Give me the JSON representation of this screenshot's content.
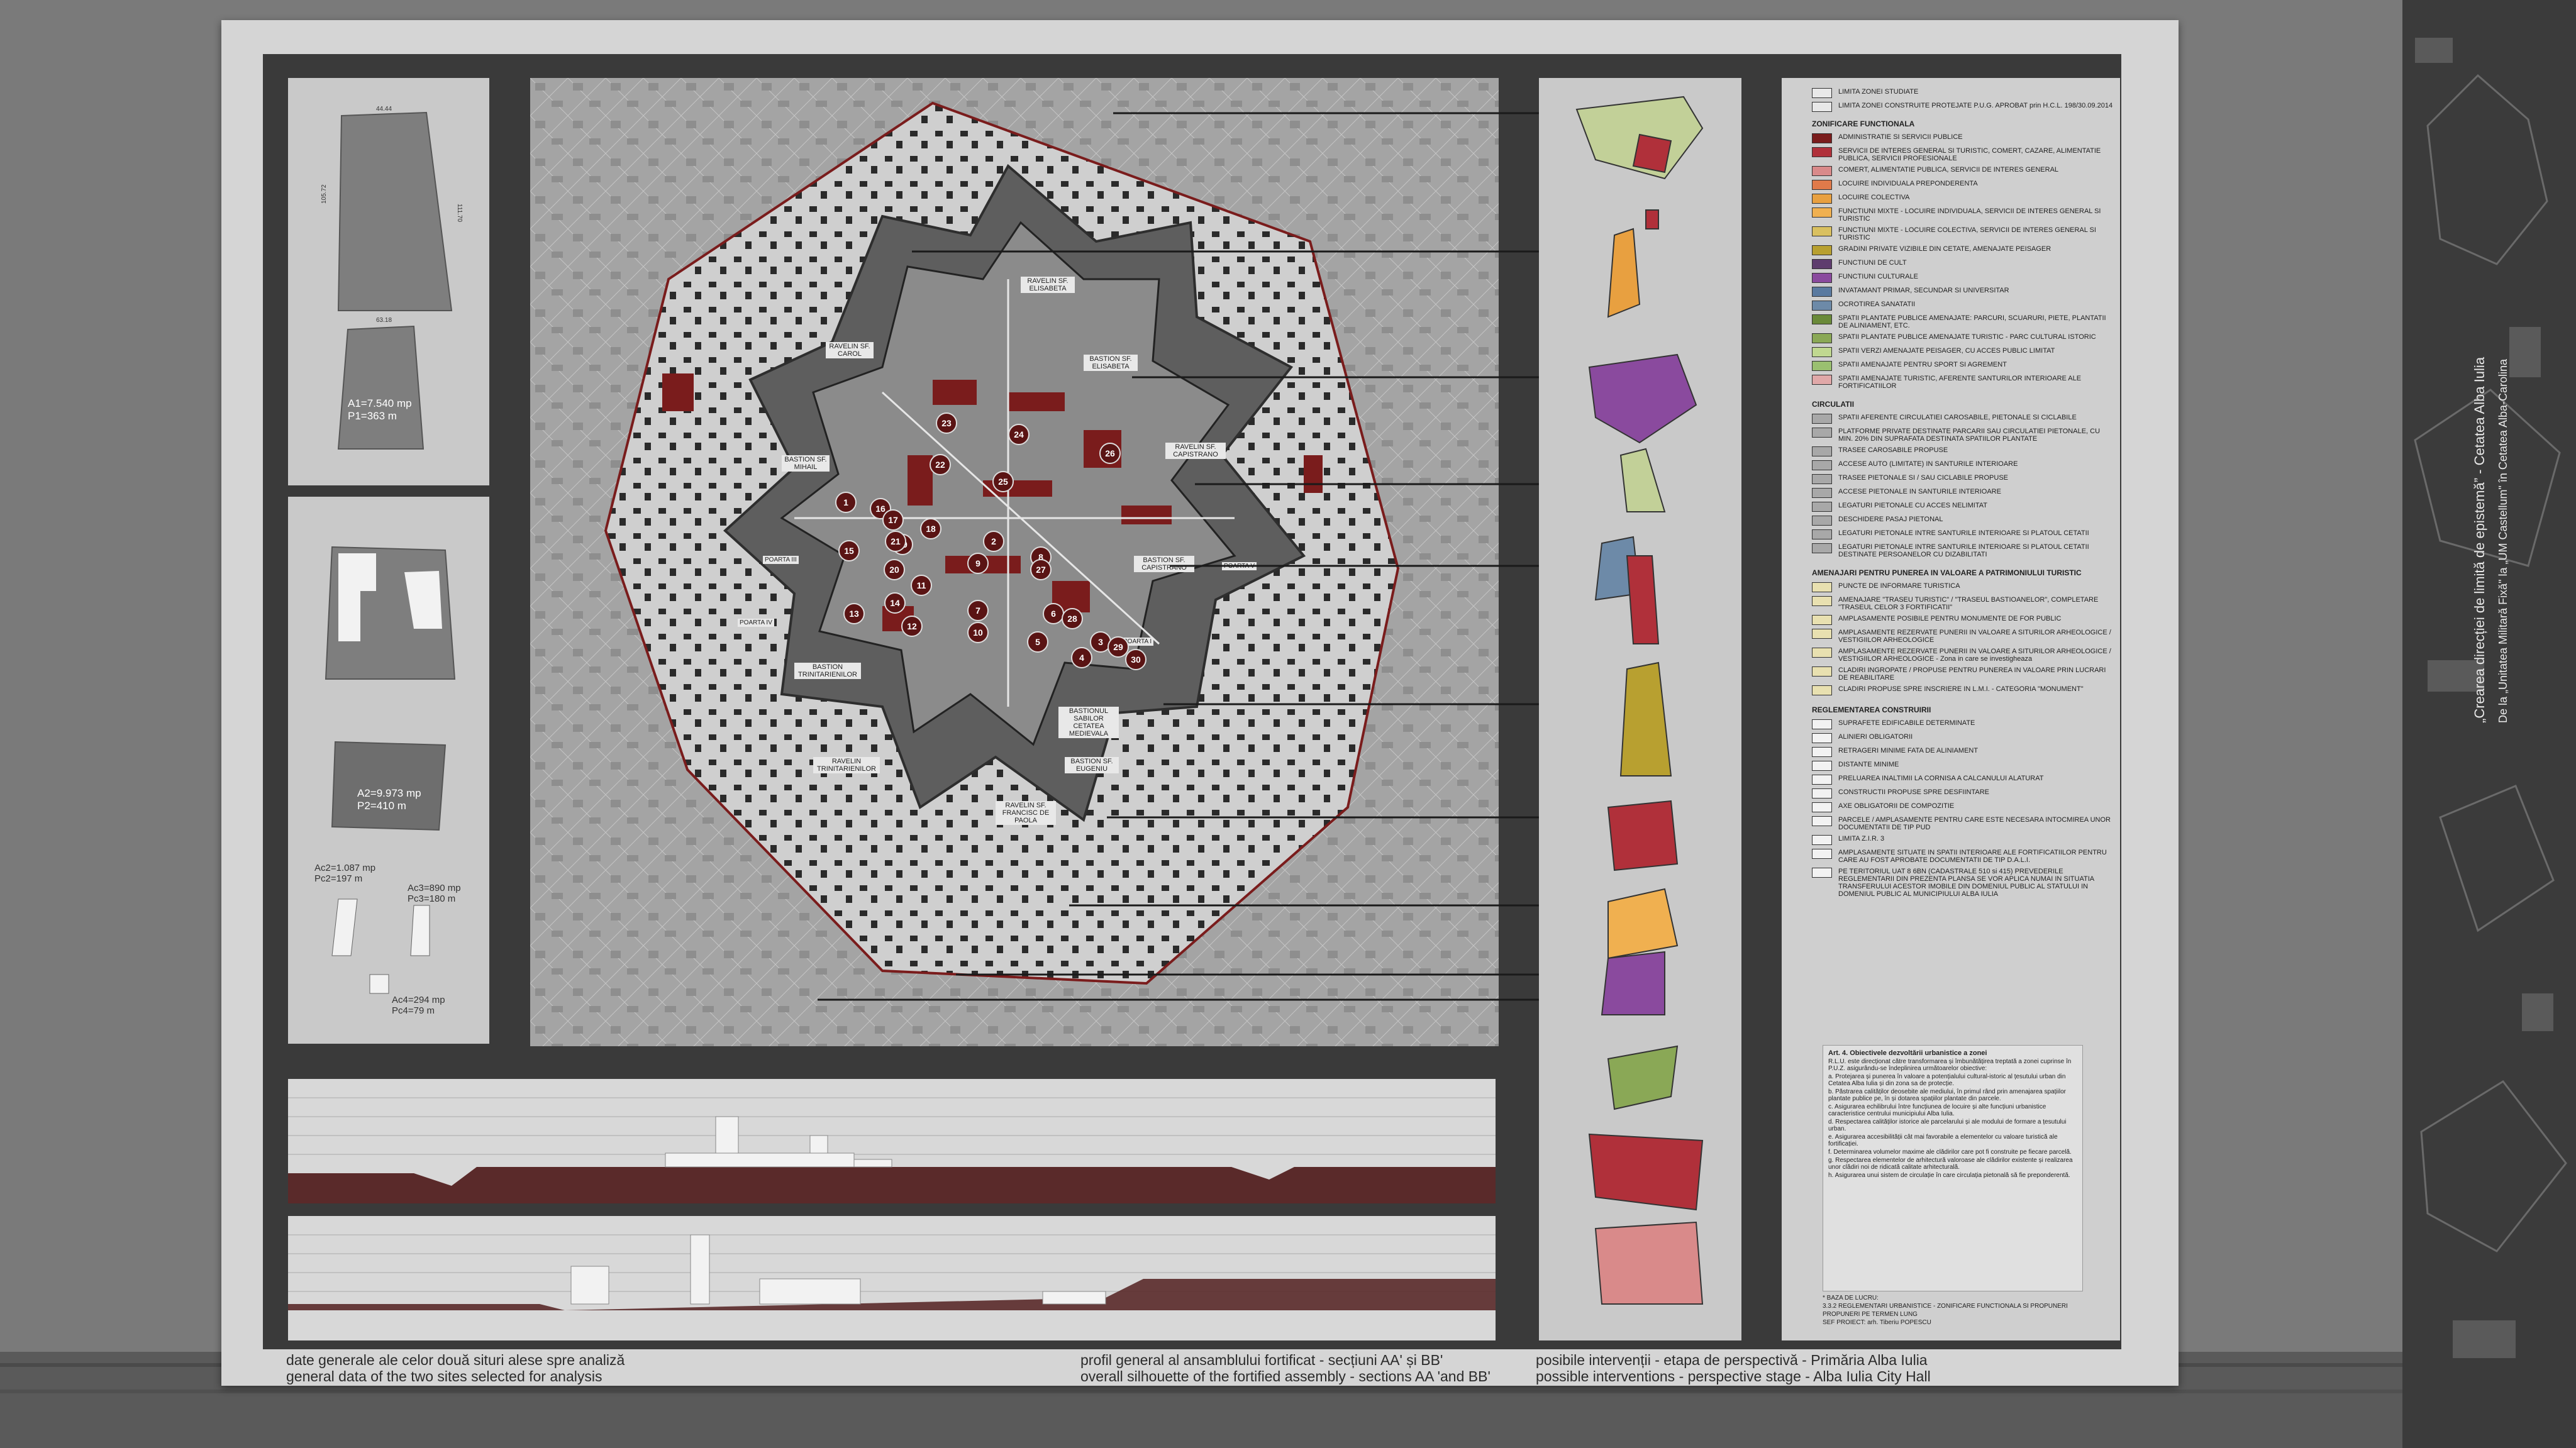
{
  "captions": {
    "left_ro": "date generale ale celor două situri alese spre analiză",
    "left_en": "general data of the two sites selected for analysis",
    "mid_ro": "profil general al ansamblului fortificat - secțiuni AA' și BB'",
    "mid_en": "overall silhouette of the fortified assembly - sections AA 'and BB'",
    "right_ro": "posibile intervenții - etapa de perspectivă - Primăria Alba Iulia",
    "right_en": "possible interventions - perspective stage - Alba Iulia City Hall"
  },
  "site_data": {
    "a1": "A1=7.540 mp",
    "p1": "P1=363 m",
    "a2": "A2=9.973 mp",
    "p2": "P2=410 m",
    "ac2": "Ac2=1.087 mp",
    "pc2": "Pc2=197 m",
    "ac3": "Ac3=890 mp",
    "pc3": "Pc3=180 m",
    "ac4": "Ac4=294 mp",
    "pc4": "Pc4=79 m"
  },
  "map_labels": {
    "ravelin_elisabeta": "RAVELIN SF. ELISABETA",
    "ravelin_carol": "RAVELIN SF. CAROL",
    "bastion_elisabeta": "BASTION SF. ELISABETA",
    "bastion_mihail": "BASTION SF. MIHAIL",
    "ravelin_capistrano": "RAVELIN SF. CAPISTRANO",
    "bastion_capistrano": "BASTION SF. CAPISTRANO",
    "bastion_treime": "BASTION TRINITARIENILOR",
    "bastion_eugeniu": "BASTION SF. EUGENIU",
    "ravelin_treime": "RAVELIN TRINITARIENILOR",
    "ravelin_paola": "RAVELIN SF. FRANCISC DE PAOLA",
    "bastion_medievala": "BASTIONUL SABILOR CETATEA MEDIEVALA",
    "poarta_1": "POARTA III",
    "poarta_2": "POARTA IV",
    "poarta_3": "POARTA V",
    "poarta_4": "POARTA I"
  },
  "markers": [
    "1",
    "2",
    "3",
    "4",
    "5",
    "6",
    "7",
    "8",
    "9",
    "10",
    "11",
    "12",
    "13",
    "14",
    "15",
    "16",
    "17",
    "18",
    "19",
    "20",
    "21",
    "22",
    "23",
    "24",
    "25",
    "26",
    "27",
    "28",
    "29",
    "30"
  ],
  "legend": {
    "items_top": [
      "LIMITA ZONEI STUDIATE",
      "LIMITA ZONEI CONSTRUITE PROTEJATE P.U.G. APROBAT prin H.C.L. 198/30.09.2014"
    ],
    "h_zoning": "ZONIFICARE FUNCTIONALA",
    "zoning": [
      {
        "color": "#7a1c1c",
        "label": "ADMINISTRATIE SI SERVICII PUBLICE"
      },
      {
        "color": "#b0303a",
        "label": "SERVICII DE INTERES GENERAL SI TURISTIC, COMERT, CAZARE, ALIMENTATIE PUBLICA, SERVICII PROFESIONALE"
      },
      {
        "color": "#d98a8a",
        "label": "COMERT, ALIMENTATIE PUBLICA, SERVICII DE INTERES GENERAL"
      },
      {
        "color": "#e07a4a",
        "label": "LOCUIRE INDIVIDUALA PREPONDERENTA"
      },
      {
        "color": "#e8a040",
        "label": "LOCUIRE COLECTIVA"
      },
      {
        "color": "#f0b050",
        "label": "FUNCTIUNI MIXTE - LOCUIRE INDIVIDUALA, SERVICII DE INTERES GENERAL SI TURISTIC"
      },
      {
        "color": "#d9c060",
        "label": "FUNCTIUNI MIXTE - LOCUIRE COLECTIVA, SERVICII DE INTERES GENERAL SI TURISTIC"
      },
      {
        "color": "#b8a030",
        "label": "GRADINI PRIVATE VIZIBILE DIN CETATE, AMENAJATE PEISAGER"
      },
      {
        "color": "#5e3c6e",
        "label": "FUNCTIUNI DE CULT"
      },
      {
        "color": "#8a4a9e",
        "label": "FUNCTIUNI CULTURALE"
      },
      {
        "color": "#5a7aa0",
        "label": "INVATAMANT PRIMAR, SECUNDAR SI UNIVERSITAR"
      },
      {
        "color": "#6d8aa8",
        "label": "OCROTIREA SANATATII"
      },
      {
        "color": "#6a8a3a",
        "label": "SPATII PLANTATE PUBLICE AMENAJATE: PARCURI, SCUARURI, PIETE, PLANTATII DE ALINIAMENT, ETC."
      },
      {
        "color": "#8aa856",
        "label": "SPATII PLANTATE PUBLICE AMENAJATE TURISTIC - PARC CULTURAL ISTORIC"
      },
      {
        "color": "#c0d890",
        "label": "SPATII VERZI AMENAJATE PEISAGER, CU ACCES PUBLIC LIMITAT"
      },
      {
        "color": "#9ac070",
        "label": "SPATII AMENAJATE PENTRU SPORT SI AGREMENT"
      },
      {
        "color": "#e0a8a8",
        "label": "SPATII AMENAJATE TURISTIC, AFERENTE SANTURILOR INTERIOARE ALE FORTIFICATIILOR"
      }
    ],
    "h_circ": "CIRCULATII",
    "circ": [
      "SPATII AFERENTE CIRCULATIEI CAROSABILE, PIETONALE SI CICLABILE",
      "PLATFORME PRIVATE DESTINATE PARCARII SAU CIRCULATIEI PIETONALE, CU MIN. 20% DIN SUPRAFATA DESTINATA SPATIILOR PLANTATE",
      "TRASEE CAROSABILE PROPUSE",
      "ACCESE AUTO (LIMITATE) IN SANTURILE INTERIOARE",
      "TRASEE PIETONALE SI / SAU CICLABILE PROPUSE",
      "ACCESE PIETONALE IN SANTURILE INTERIOARE",
      "LEGATURI PIETONALE CU ACCES NELIMITAT",
      "DESCHIDERE PASAJ PIETONAL",
      "LEGATURI PIETONALE INTRE SANTURILE INTERIOARE SI PLATOUL CETATII",
      "LEGATURI PIETONALE INTRE SANTURILE INTERIOARE SI PLATOUL CETATII DESTINATE PERSOANELOR CU DIZABILITATI"
    ],
    "h_amen": "AMENAJARI PENTRU PUNEREA IN VALOARE A PATRIMONIULUI TURISTIC",
    "amen": [
      "PUNCTE DE INFORMARE TURISTICA",
      "AMENAJARE \"TRASEU TURISTIC\" / \"TRASEUL BASTIOANELOR\", COMPLETARE \"TRASEUL CELOR 3 FORTIFICATII\"",
      "AMPLASAMENTE POSIBILE PENTRU MONUMENTE DE FOR PUBLIC",
      "AMPLASAMENTE REZERVATE PUNERII IN VALOARE A SITURILOR ARHEOLOGICE / VESTIGIILOR ARHEOLOGICE",
      "AMPLASAMENTE REZERVATE PUNERII IN VALOARE A SITURILOR ARHEOLOGICE / VESTIGIILOR ARHEOLOGICE - Zona in care se investigheaza",
      "CLADIRI INGROPATE / PROPUSE PENTRU PUNEREA IN VALOARE PRIN LUCRARI DE REABILITARE",
      "CLADIRI PROPUSE SPRE INSCRIERE IN L.M.I. - CATEGORIA \"MONUMENT\""
    ],
    "h_regl": "REGLEMENTAREA CONSTRUIRII",
    "regl": [
      "SUPRAFETE EDIFICABILE DETERMINATE",
      "ALINIERI OBLIGATORII",
      "RETRAGERI MINIME FATA DE ALINIAMENT",
      "DISTANTE MINIME",
      "PRELUAREA INALTIMII LA CORNISA A CALCANULUI ALATURAT",
      "CONSTRUCTII PROPUSE SPRE DESFIINTARE",
      "AXE OBLIGATORII DE COMPOZITIE",
      "PARCELE / AMPLASAMENTE PENTRU CARE ESTE NECESARA INTOCMIREA UNOR DOCUMENTATII DE TIP PUD",
      "LIMITA Z.I.R. 3",
      "AMPLASAMENTE SITUATE IN SPATII INTERIOARE ALE FORTIFICATIILOR PENTRU CARE AU FOST APROBATE DOCUMENTATII DE TIP D.A.L.I.",
      "PE TERITORIUL UAT 8 6BN (CADASTRALE 510 si 415) PREVEDERILE REGLEMENTARII DIN PREZENTA PLANSA SE VOR APLICA NUMAI IN SITUATIA TRANSFERULUI ACESTOR IMOBILE DIN DOMENIUL PUBLIC AL STATULUI IN DOMENIUL PUBLIC AL MUNICIPIULUI ALBA IULIA"
    ]
  },
  "objectives": {
    "title": "Art. 4. Obiectivele dezvoltării urbanistice a zonei",
    "intro": "R.L.U. este direcționat către transformarea și îmbunătățirea treptată a zonei cuprinse în P.U.Z. asigurându-se îndeplinirea următoarelor obiective:",
    "items": [
      "a. Protejarea și punerea în valoare a potențialului cultural-istoric al țesutului urban din Cetatea Alba Iulia și din zona sa de protecție.",
      "b. Păstrarea calităților deosebite ale mediului, în primul rând prin amenajarea spațiilor plantate publice pe, în și dotarea spațiilor plantate din parcele.",
      "c. Asigurarea echilibrului între funcțiunea de locuire și alte funcțiuni urbanistice caracteristice centrului municipiului Alba Iulia.",
      "d. Respectarea calităților istorice ale parcelarului și ale modului de formare a țesutului urban.",
      "e. Asigurarea accesibilității cât mai favorabile a elementelor cu valoare turistică ale fortificației.",
      "f. Determinarea volumelor maxime ale clădirilor care pot fi construite pe fiecare parcelă.",
      "g. Respectarea elementelor de arhitectură valoroase ale clădirilor existente și realizarea unor clădiri noi de ridicată calitate arhitecturală.",
      "h. Asigurarea unui sistem de circulație în care circulația pietonală să fie preponderentă."
    ]
  },
  "footnote": [
    "* BAZA DE LUCRU:",
    "3.3.2 REGLEMENTARI URBANISTICE - ZONIFICARE FUNCTIONALA SI PROPUNERI",
    "PROPUNERI PE TERMEN LUNG",
    "SEF PROIECT: arh. Tiberiu POPESCU"
  ],
  "side_text": [
    "„Crearea direcției de limită de epistemă” - Cetatea Alba Iulia",
    "De la „Unitatea Militară Fixă\" la „UM Castellum\" în Cetatea Alba-Carolina"
  ],
  "colors": {
    "board": "#d5d5d5",
    "dark_frame": "#3a3a3a",
    "map_fill": "#b9b9b9",
    "accent_red": "#7a1c1c"
  }
}
